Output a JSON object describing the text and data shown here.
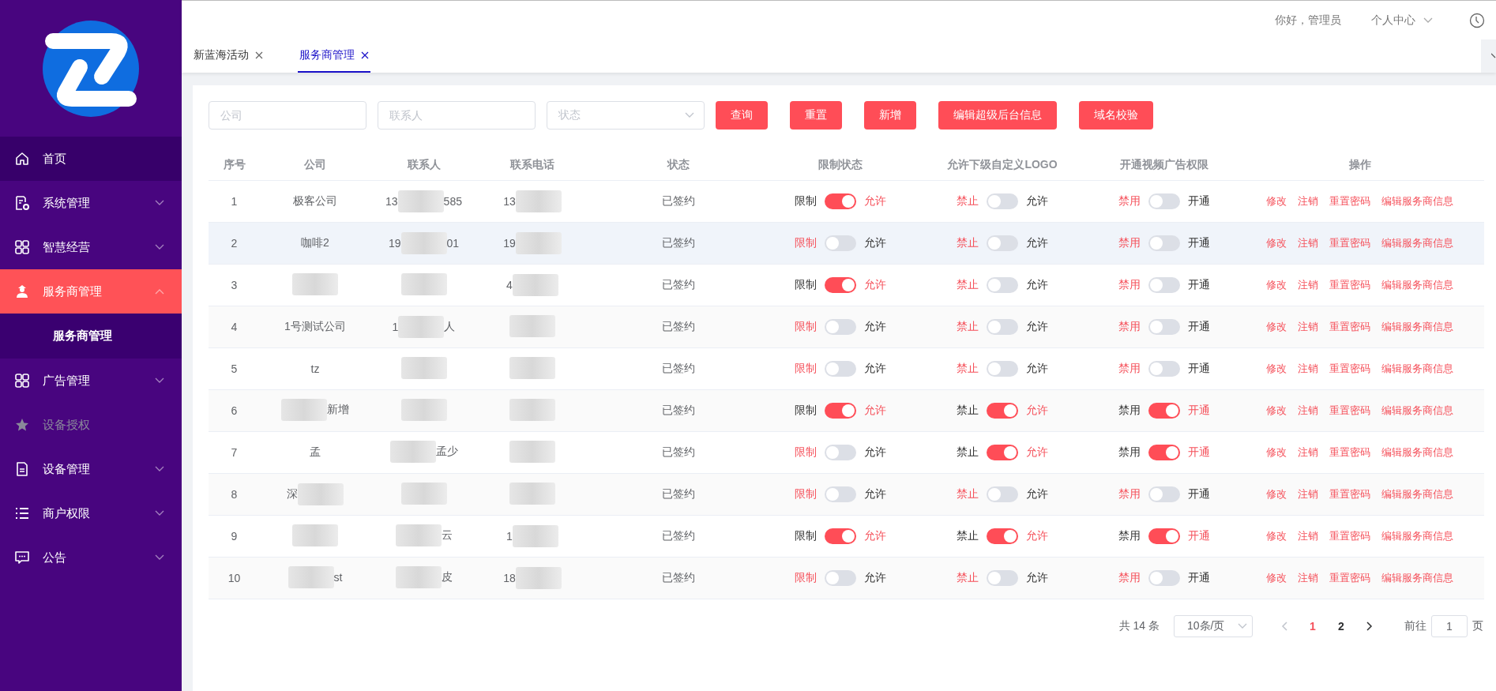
{
  "sidebar": {
    "items": [
      {
        "label": "首页",
        "selected": false,
        "hovered": true,
        "expandable": false,
        "disabled": false
      },
      {
        "label": "系统管理",
        "selected": false,
        "hovered": false,
        "expandable": true,
        "expanded": false,
        "disabled": false
      },
      {
        "label": "智慧经营",
        "selected": false,
        "hovered": false,
        "expandable": true,
        "expanded": false,
        "disabled": false
      },
      {
        "label": "服务商管理",
        "selected": true,
        "hovered": false,
        "expandable": true,
        "expanded": true,
        "disabled": false,
        "children": [
          {
            "label": "服务商管理",
            "selected": true
          }
        ]
      },
      {
        "label": "广告管理",
        "selected": false,
        "hovered": false,
        "expandable": true,
        "expanded": false,
        "disabled": false
      },
      {
        "label": "设备授权",
        "selected": false,
        "hovered": false,
        "expandable": false,
        "disabled": true
      },
      {
        "label": "设备管理",
        "selected": false,
        "hovered": false,
        "expandable": true,
        "expanded": false,
        "disabled": false
      },
      {
        "label": "商户权限",
        "selected": false,
        "hovered": false,
        "expandable": true,
        "expanded": false,
        "disabled": false
      },
      {
        "label": "公告",
        "selected": false,
        "hovered": false,
        "expandable": true,
        "expanded": false,
        "disabled": false
      }
    ]
  },
  "header": {
    "greeting": "你好，管理员",
    "user_menu": "个人中心"
  },
  "tabs": [
    {
      "label": "新蓝海活动",
      "selected": false
    },
    {
      "label": "服务商管理",
      "selected": true
    }
  ],
  "filters": {
    "company": {
      "placeholder": "公司"
    },
    "contact": {
      "placeholder": "联系人"
    },
    "status": {
      "placeholder": "状态"
    }
  },
  "buttons": [
    "查询",
    "重置",
    "新增",
    "编辑超级后台信息",
    "域名校验"
  ],
  "table": {
    "columns": [
      "序号",
      "公司",
      "联系人",
      "联系电话",
      "状态",
      "限制状态",
      "允许下级自定义LOGO",
      "开通视频广告权限",
      "操作"
    ],
    "rows": [
      {
        "index": "1",
        "highlighted": false,
        "company": {
          "redacted": false,
          "text": "极客公司"
        },
        "contact": {
          "redacted": true,
          "before": "13",
          "after": "585"
        },
        "phone": {
          "redacted": true,
          "before": "13"
        },
        "status": "已签约",
        "limit": {
          "off_label": "限制",
          "on_label": "允许",
          "on": true
        },
        "logo": {
          "off_label": "禁止",
          "on_label": "允许",
          "on": false
        },
        "video": {
          "off_label": "禁用",
          "on_label": "开通",
          "on": false
        },
        "actions": [
          "修改",
          "注销",
          "重置密码",
          "编辑服务商信息"
        ]
      },
      {
        "index": "2",
        "highlighted": true,
        "company": {
          "redacted": false,
          "text": "咖啡2"
        },
        "contact": {
          "redacted": true,
          "before": "19",
          "after": "01"
        },
        "phone": {
          "redacted": true,
          "before": "19"
        },
        "status": "已签约",
        "limit": {
          "off_label": "限制",
          "on_label": "允许",
          "on": false
        },
        "logo": {
          "off_label": "禁止",
          "on_label": "允许",
          "on": false
        },
        "video": {
          "off_label": "禁用",
          "on_label": "开通",
          "on": false
        },
        "actions": [
          "修改",
          "注销",
          "重置密码",
          "编辑服务商信息"
        ]
      },
      {
        "index": "3",
        "highlighted": false,
        "company": {
          "redacted": true
        },
        "contact": {
          "redacted": true
        },
        "phone": {
          "redacted": true,
          "before": "4"
        },
        "status": "已签约",
        "limit": {
          "off_label": "限制",
          "on_label": "允许",
          "on": true
        },
        "logo": {
          "off_label": "禁止",
          "on_label": "允许",
          "on": false
        },
        "video": {
          "off_label": "禁用",
          "on_label": "开通",
          "on": false
        },
        "actions": [
          "修改",
          "注销",
          "重置密码",
          "编辑服务商信息"
        ]
      },
      {
        "index": "4",
        "highlighted": false,
        "company": {
          "redacted": false,
          "text": "1号测试公司"
        },
        "contact": {
          "redacted": true,
          "before": "1",
          "after": "人"
        },
        "phone": {
          "redacted": true
        },
        "status": "已签约",
        "limit": {
          "off_label": "限制",
          "on_label": "允许",
          "on": false
        },
        "logo": {
          "off_label": "禁止",
          "on_label": "允许",
          "on": false
        },
        "video": {
          "off_label": "禁用",
          "on_label": "开通",
          "on": false
        },
        "actions": [
          "修改",
          "注销",
          "重置密码",
          "编辑服务商信息"
        ]
      },
      {
        "index": "5",
        "highlighted": false,
        "company": {
          "redacted": false,
          "text": "tz"
        },
        "contact": {
          "redacted": true
        },
        "phone": {
          "redacted": true
        },
        "status": "已签约",
        "limit": {
          "off_label": "限制",
          "on_label": "允许",
          "on": false
        },
        "logo": {
          "off_label": "禁止",
          "on_label": "允许",
          "on": false
        },
        "video": {
          "off_label": "禁用",
          "on_label": "开通",
          "on": false
        },
        "actions": [
          "修改",
          "注销",
          "重置密码",
          "编辑服务商信息"
        ]
      },
      {
        "index": "6",
        "highlighted": false,
        "company": {
          "redacted": true,
          "after": "新增"
        },
        "contact": {
          "redacted": true
        },
        "phone": {
          "redacted": true
        },
        "status": "已签约",
        "limit": {
          "off_label": "限制",
          "on_label": "允许",
          "on": true
        },
        "logo": {
          "off_label": "禁止",
          "on_label": "允许",
          "on": true
        },
        "video": {
          "off_label": "禁用",
          "on_label": "开通",
          "on": true
        },
        "actions": [
          "修改",
          "注销",
          "重置密码",
          "编辑服务商信息"
        ]
      },
      {
        "index": "7",
        "highlighted": false,
        "company": {
          "redacted": false,
          "text": "孟"
        },
        "contact": {
          "redacted": true,
          "after": "孟少"
        },
        "phone": {
          "redacted": true
        },
        "status": "已签约",
        "limit": {
          "off_label": "限制",
          "on_label": "允许",
          "on": false
        },
        "logo": {
          "off_label": "禁止",
          "on_label": "允许",
          "on": true
        },
        "video": {
          "off_label": "禁用",
          "on_label": "开通",
          "on": true
        },
        "actions": [
          "修改",
          "注销",
          "重置密码",
          "编辑服务商信息"
        ]
      },
      {
        "index": "8",
        "highlighted": false,
        "company": {
          "redacted": true,
          "before": "深"
        },
        "contact": {
          "redacted": true
        },
        "phone": {
          "redacted": true
        },
        "status": "已签约",
        "limit": {
          "off_label": "限制",
          "on_label": "允许",
          "on": false
        },
        "logo": {
          "off_label": "禁止",
          "on_label": "允许",
          "on": false
        },
        "video": {
          "off_label": "禁用",
          "on_label": "开通",
          "on": false
        },
        "actions": [
          "修改",
          "注销",
          "重置密码",
          "编辑服务商信息"
        ]
      },
      {
        "index": "9",
        "highlighted": false,
        "company": {
          "redacted": true
        },
        "contact": {
          "redacted": true,
          "after": "云"
        },
        "phone": {
          "redacted": true,
          "before": "1"
        },
        "status": "已签约",
        "limit": {
          "off_label": "限制",
          "on_label": "允许",
          "on": true
        },
        "logo": {
          "off_label": "禁止",
          "on_label": "允许",
          "on": true
        },
        "video": {
          "off_label": "禁用",
          "on_label": "开通",
          "on": true
        },
        "actions": [
          "修改",
          "注销",
          "重置密码",
          "编辑服务商信息"
        ]
      },
      {
        "index": "10",
        "highlighted": false,
        "company": {
          "redacted": true,
          "after": "st"
        },
        "contact": {
          "redacted": true,
          "after": "皮"
        },
        "phone": {
          "redacted": true,
          "before": "18"
        },
        "status": "已签约",
        "limit": {
          "off_label": "限制",
          "on_label": "允许",
          "on": false
        },
        "logo": {
          "off_label": "禁止",
          "on_label": "允许",
          "on": false
        },
        "video": {
          "off_label": "禁用",
          "on_label": "开通",
          "on": false
        },
        "actions": [
          "修改",
          "注销",
          "重置密码",
          "编辑服务商信息"
        ]
      }
    ]
  },
  "pagination": {
    "total": "共 14 条",
    "page_size": "10条/页",
    "prev": {
      "disabled": true
    },
    "pages": [
      {
        "label": "1",
        "selected": true
      },
      {
        "label": "2",
        "selected": false
      }
    ],
    "next": {
      "disabled": false
    },
    "goto_label": "前往",
    "goto_value": "1",
    "goto_suffix": "页"
  }
}
